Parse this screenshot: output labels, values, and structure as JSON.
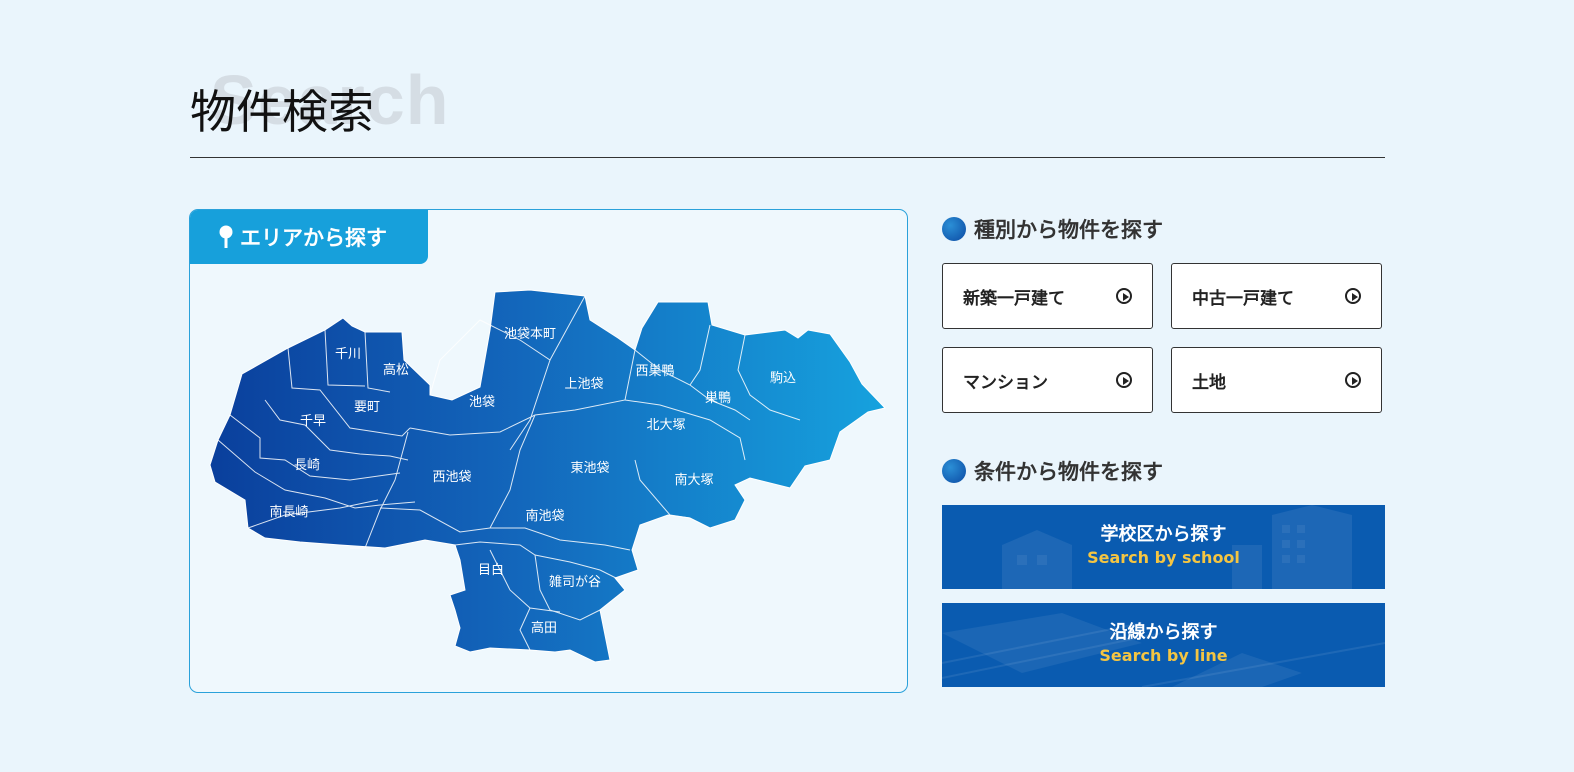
{
  "header": {
    "bg_word": "Search",
    "title": "物件検索"
  },
  "area": {
    "tab_label": "エリアから探す",
    "districts": [
      "千川",
      "高松",
      "要町",
      "千早",
      "長崎",
      "南長崎",
      "池袋本町",
      "池袋",
      "上池袋",
      "西巣鴨",
      "巣鴨",
      "駒込",
      "北大塚",
      "西池袋",
      "東池袋",
      "南大塚",
      "南池袋",
      "目白",
      "雑司が谷",
      "高田"
    ]
  },
  "category": {
    "heading": "種別から物件を探す",
    "buttons": [
      "新築一戸建て",
      "中古一戸建て",
      "マンション",
      "土地"
    ]
  },
  "conditions": {
    "heading": "条件から物件を探す",
    "school": {
      "title": "学校区から探す",
      "subtitle": "Search by school"
    },
    "line": {
      "title": "沿線から探す",
      "subtitle": "Search by line"
    }
  },
  "colors": {
    "accent": "#17a0db",
    "banner": "#0a5bb0",
    "banner_sub": "#f4c542"
  }
}
